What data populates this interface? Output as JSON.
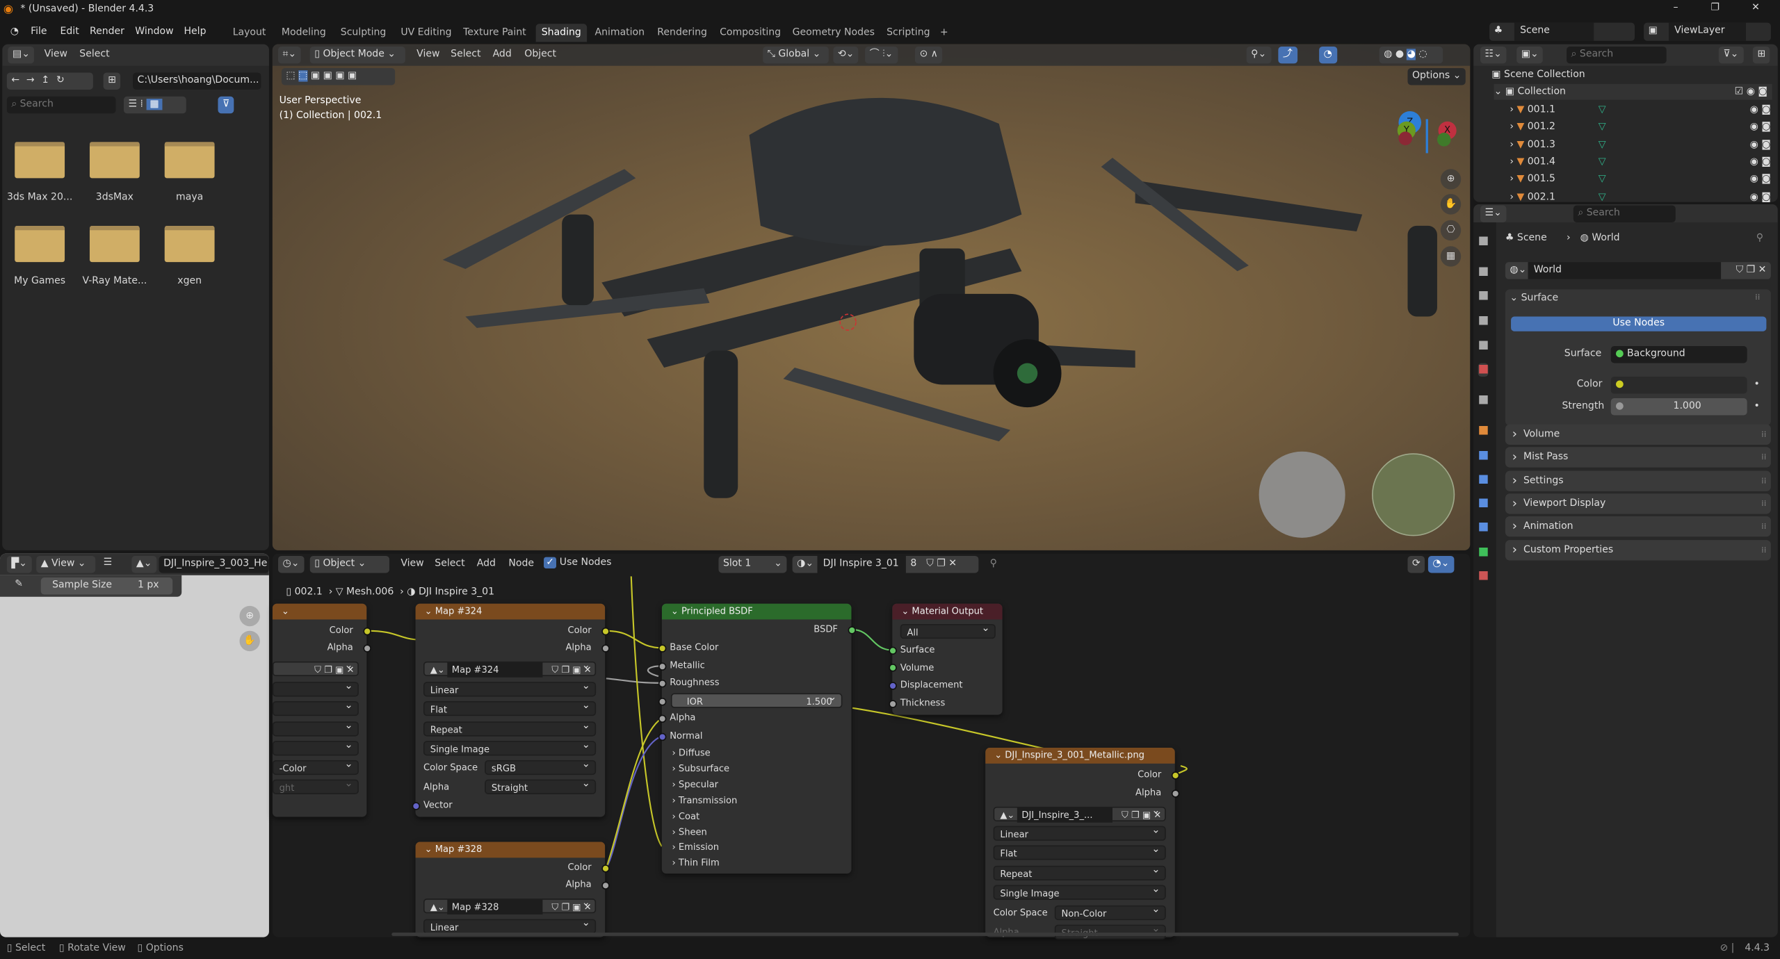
{
  "window": {
    "title": "* (Unsaved) - Blender 4.4.3",
    "minimize": "–",
    "maximize": "❐",
    "close": "✕"
  },
  "menu": [
    "File",
    "Edit",
    "Render",
    "Window",
    "Help"
  ],
  "workspaces": [
    "Layout",
    "Modeling",
    "Sculpting",
    "UV Editing",
    "Texture Paint",
    "Shading",
    "Animation",
    "Rendering",
    "Compositing",
    "Geometry Nodes",
    "Scripting",
    "+"
  ],
  "active_workspace": "Shading",
  "scene_selector": {
    "scene": "Scene",
    "view_layer": "ViewLayer"
  },
  "file_browser": {
    "menu": [
      "View",
      "Select"
    ],
    "path": "C:\\Users\\hoang\\Docum...",
    "search_placeholder": "Search",
    "folders": [
      "3ds Max 20...",
      "3dsMax",
      "maya",
      "My Games",
      "V-Ray Mate...",
      "xgen"
    ],
    "folder_color": "#d0ae66"
  },
  "viewport": {
    "mode": "Object Mode",
    "menu": [
      "View",
      "Select",
      "Add",
      "Object"
    ],
    "orientation": "Global",
    "options": "Options",
    "overlay_title": "User Perspective",
    "overlay_sub": "(1) Collection | 002.1",
    "gizmo": {
      "x": "X",
      "y": "Y",
      "z": "Z"
    }
  },
  "outliner": {
    "search_placeholder": "Search",
    "scene_collection": "Scene Collection",
    "collection": "Collection",
    "items": [
      "001.1",
      "001.2",
      "001.3",
      "001.4",
      "001.5",
      "002.1"
    ]
  },
  "properties": {
    "search_placeholder": "Search",
    "breadcrumb": [
      "Scene",
      "World"
    ],
    "world_name": "World",
    "surface_panel": "Surface",
    "use_nodes": "Use Nodes",
    "surface_label": "Surface",
    "surface_value": "Background",
    "color_label": "Color",
    "strength_label": "Strength",
    "strength_value": "1.000",
    "panels": [
      "Volume",
      "Mist Pass",
      "Settings",
      "Viewport Display",
      "Animation",
      "Custom Properties"
    ]
  },
  "image_editor": {
    "view": "View",
    "image_name": "DJI_Inspire_3_003_He",
    "sample_size_label": "Sample Size",
    "sample_size_value": "1 px"
  },
  "node_editor": {
    "object_mode": "Object",
    "menu": [
      "View",
      "Select",
      "Add",
      "Node"
    ],
    "use_nodes": "Use Nodes",
    "slot": "Slot 1",
    "material": "DJI Inspire 3_01",
    "users": "8",
    "breadcrumb": [
      "002.1",
      "Mesh.006",
      "DJI Inspire 3_01"
    ],
    "left_node": {
      "outputs": [
        "Color",
        "Alpha"
      ],
      "colorspace_partial": "-Color",
      "alpha_partial": "ght"
    },
    "map324": {
      "title": "Map #324",
      "outputs": [
        "Color",
        "Alpha"
      ],
      "image": "Map #324",
      "interp": "Linear",
      "proj": "Flat",
      "ext": "Repeat",
      "source": "Single Image",
      "cs_label": "Color Space",
      "cs": "sRGB",
      "alpha_label": "Alpha",
      "alpha": "Straight",
      "vector": "Vector"
    },
    "map328": {
      "title": "Map #328",
      "outputs": [
        "Color",
        "Alpha"
      ],
      "image": "Map #328",
      "interp": "Linear"
    },
    "bsdf": {
      "title": "Principled BSDF",
      "output": "BSDF",
      "inputs": [
        "Base Color",
        "Metallic",
        "Roughness"
      ],
      "ior_label": "IOR",
      "ior": "1.500",
      "inputs2": [
        "Alpha",
        "Normal"
      ],
      "panels": [
        "Diffuse",
        "Subsurface",
        "Specular",
        "Transmission",
        "Coat",
        "Sheen",
        "Emission",
        "Thin Film"
      ]
    },
    "output": {
      "title": "Material Output",
      "target": "All",
      "inputs": [
        "Surface",
        "Volume",
        "Displacement",
        "Thickness"
      ]
    },
    "metallic": {
      "title": "DJI_Inspire_3_001_Metallic.png",
      "outputs": [
        "Color",
        "Alpha"
      ],
      "image": "DJI_Inspire_3_...",
      "interp": "Linear",
      "proj": "Flat",
      "ext": "Repeat",
      "source": "Single Image",
      "cs_label": "Color Space",
      "cs": "Non-Color",
      "alpha_label": "Alpha",
      "alpha": "Straight"
    },
    "colors": {
      "texture_header": "#7a4a1e",
      "shader_header": "#2b6b2b",
      "output_header": "#4a1f28",
      "color_socket": "#c7c729",
      "shader_socket": "#63c763",
      "vector_socket": "#6363c7",
      "float_socket": "#a1a1a1"
    }
  },
  "status": {
    "items": [
      "Select",
      "Rotate View",
      "Options"
    ],
    "version": "4.4.3"
  }
}
